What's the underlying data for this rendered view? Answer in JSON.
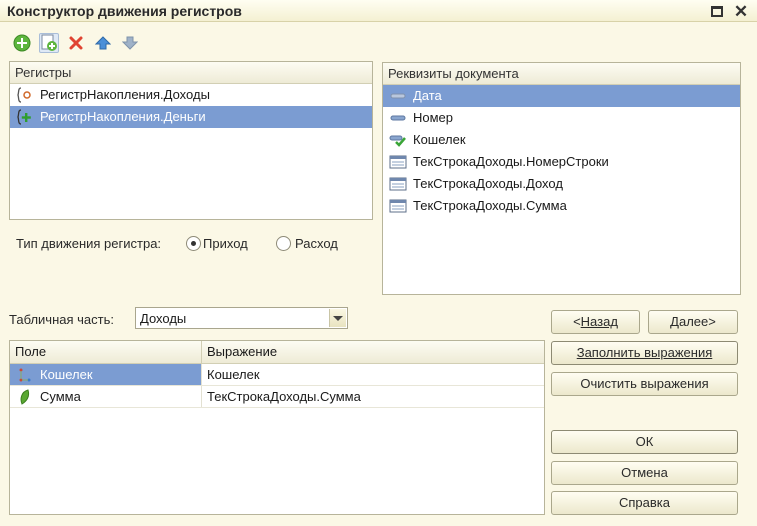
{
  "window": {
    "title": "Конструктор движения регистров"
  },
  "toolbar": {
    "icons": [
      "add-icon",
      "add-copy-icon",
      "delete-icon",
      "move-up-icon",
      "move-down-icon"
    ]
  },
  "registers": {
    "header": "Регистры",
    "items": [
      {
        "label": "РегистрНакопления.Доходы",
        "icon": "accumulation-register-icon",
        "selected": false
      },
      {
        "label": "РегистрНакопления.Деньги",
        "icon": "accumulation-register-add-icon",
        "selected": true
      }
    ]
  },
  "movement_type": {
    "label": "Тип движения регистра:",
    "options": [
      {
        "label": "Приход",
        "checked": true
      },
      {
        "label": "Расход",
        "checked": false
      }
    ]
  },
  "document_attributes": {
    "header": "Реквизиты документа",
    "items": [
      {
        "label": "Дата",
        "icon": "attribute-icon",
        "selected": true
      },
      {
        "label": "Номер",
        "icon": "attribute-icon",
        "selected": false
      },
      {
        "label": "Кошелек",
        "icon": "attribute-check-icon",
        "selected": false
      },
      {
        "label": "ТекСтрокаДоходы.НомерСтроки",
        "icon": "table-part-icon",
        "selected": false
      },
      {
        "label": "ТекСтрокаДоходы.Доход",
        "icon": "table-part-icon",
        "selected": false
      },
      {
        "label": "ТекСтрокаДоходы.Сумма",
        "icon": "table-part-icon",
        "selected": false
      }
    ]
  },
  "table_part": {
    "label": "Табличная часть:",
    "value": "Доходы"
  },
  "nav": {
    "back_label": "Назад",
    "next_label": "Далее>"
  },
  "actions": {
    "fill_label": "Заполнить выражения",
    "clear_label": "Очистить выражения",
    "ok_label": "ОК",
    "cancel_label": "Отмена",
    "help_label": "Справка"
  },
  "grid": {
    "columns": [
      "Поле",
      "Выражение"
    ],
    "rows": [
      {
        "field": "Кошелек",
        "expression": "Кошелек",
        "icon": "dimension-icon",
        "selected": true
      },
      {
        "field": "Сумма",
        "expression": "ТекСтрокаДоходы.Сумма",
        "icon": "resource-icon",
        "selected": false
      }
    ]
  },
  "colors": {
    "background": "#fbf8e6",
    "selection": "#7b9cd2"
  }
}
